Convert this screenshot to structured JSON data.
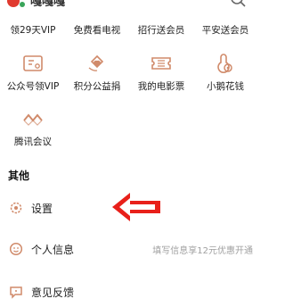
{
  "header": {
    "username": "嘎嘎嘎"
  },
  "grid": {
    "row1": [
      {
        "label": "领29天VIP"
      },
      {
        "label": "免费看电视"
      },
      {
        "label": "招行送会员"
      },
      {
        "label": "平安送会员"
      }
    ],
    "row2": [
      {
        "label": "公众号领VIP",
        "icon": "ticket-icon"
      },
      {
        "label": "积分公益捐",
        "icon": "heart-hands-icon"
      },
      {
        "label": "我的电影票",
        "icon": "movie-ticket-icon"
      },
      {
        "label": "小鹅花钱",
        "icon": "goose-icon"
      }
    ],
    "row3": [
      {
        "label": "腾讯会议",
        "icon": "meeting-icon"
      }
    ]
  },
  "others": {
    "title": "其他",
    "items": [
      {
        "label": "设置",
        "icon": "settings-icon"
      },
      {
        "label": "个人信息",
        "icon": "profile-icon",
        "hint": "填写信息享12元优惠开通"
      },
      {
        "label": "意见反馈",
        "icon": "feedback-icon"
      }
    ]
  },
  "colors": {
    "icon": "#d08a6a",
    "arrow": "#e8201a",
    "hint": "#a0a0a0"
  }
}
